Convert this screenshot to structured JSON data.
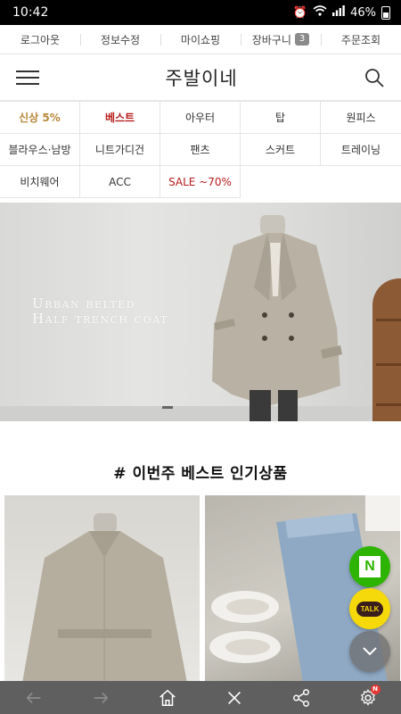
{
  "status_bar": {
    "time": "10:42",
    "battery": "46%"
  },
  "top_links": [
    {
      "label": "로그아웃"
    },
    {
      "label": "정보수정"
    },
    {
      "label": "마이쇼핑"
    },
    {
      "label": "장바구니",
      "badge": "3"
    },
    {
      "label": "주문조회"
    }
  ],
  "header": {
    "logo": "주발이네"
  },
  "categories": [
    "신상 5%",
    "베스트",
    "아우터",
    "탑",
    "원피스",
    "블라우스·남방",
    "니트가디건",
    "팬츠",
    "스커트",
    "트레이닝",
    "비치웨어",
    "ACC",
    "SALE ~70%"
  ],
  "banner": {
    "line1": "Urban belted",
    "line2": "Half trench coat",
    "active_slide": 1,
    "slide_count": 4
  },
  "section": {
    "title": "# 이번주 베스트 인기상품"
  },
  "floating": {
    "naver_label": "N",
    "talk_label": "TALK"
  },
  "colors": {
    "accent_new": "#b8893a",
    "accent_best": "#b71c1c",
    "naver_green": "#2db400",
    "kakao_yellow": "#f5d90a",
    "nav_bg": "#5f5f5f"
  },
  "bottom_nav": {
    "settings_badge": "N"
  }
}
